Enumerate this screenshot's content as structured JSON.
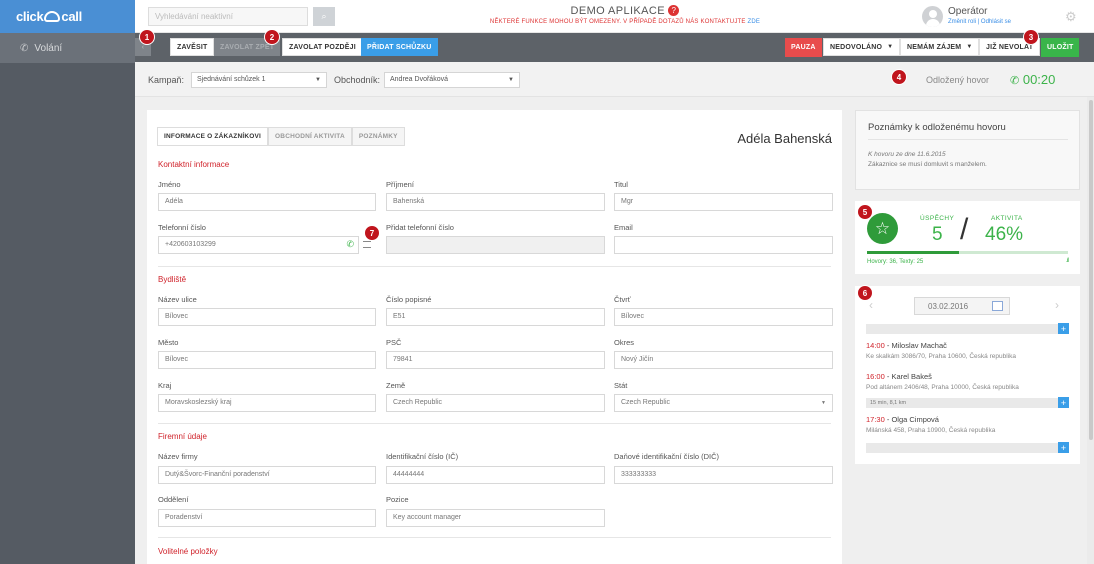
{
  "app": {
    "logo_text_1": "click",
    "logo_text_2": "call"
  },
  "sidebar": {
    "items": [
      {
        "label": "Volání",
        "icon": "phone-icon"
      }
    ]
  },
  "topbar": {
    "search_placeholder": "Vyhledávání neaktivní",
    "title": "DEMO APLIKACE",
    "subtitle": "NĚKTERÉ FUNKCE MOHOU BÝT OMEZENY. V PŘÍPADĚ DOTAZŮ NÁS KONTAKTUJTE",
    "subtitle_link": "ZDE",
    "user_name": "Operátor",
    "user_change_role": "Změnit roli",
    "user_sep": "|",
    "user_logout": "Odhlásit se"
  },
  "actions": {
    "hangup": "ZAVĚSIT",
    "callback": "ZAVOLAT ZPĚT",
    "call_later": "ZAVOLAT POZDĚJI",
    "add_meeting": "PŘIDAT SCHŮZKU",
    "pause": "PAUZA",
    "not_reached": "NEDOVOLÁNO",
    "not_interested": "NEMÁM ZÁJEM",
    "no_more_calls": "JIŽ NEVOLAT",
    "save": "ULOŽIT"
  },
  "markers": [
    "1",
    "2",
    "3",
    "4",
    "5",
    "6",
    "7"
  ],
  "campaign": {
    "label": "Kampaň:",
    "value": "Sjednávání schůzek 1",
    "dealer_label": "Obchodník:",
    "dealer_value": "Andrea Dvořáková",
    "delayed_label": "Odložený hovor",
    "timer": "00:20"
  },
  "tabs": [
    "INFORMACE O ZÁKAZNÍKOVI",
    "OBCHODNÍ AKTIVITA",
    "POZNÁMKY"
  ],
  "customer_name": "Adéla Bahenská",
  "sections": {
    "contact": "Kontaktní informace",
    "address": "Bydliště",
    "company": "Firemní údaje",
    "optional": "Volitelné položky"
  },
  "fields": {
    "first_name": {
      "label": "Jméno",
      "value": "Adéla"
    },
    "last_name": {
      "label": "Příjmení",
      "value": "Bahenská"
    },
    "title": {
      "label": "Titul",
      "value": "Mgr"
    },
    "phone": {
      "label": "Telefonní číslo",
      "value": "+420603103299"
    },
    "add_phone": {
      "label": "Přidat telefonní číslo",
      "value": ""
    },
    "email": {
      "label": "Email",
      "value": ""
    },
    "street": {
      "label": "Název ulice",
      "value": "Bílovec"
    },
    "house_no": {
      "label": "Číslo popisné",
      "value": "E51"
    },
    "district": {
      "label": "Čtvrť",
      "value": "Bílovec"
    },
    "city": {
      "label": "Město",
      "value": "Bílovec"
    },
    "zip": {
      "label": "PSČ",
      "value": "79841"
    },
    "county": {
      "label": "Okres",
      "value": "Nový Jičín"
    },
    "region": {
      "label": "Kraj",
      "value": "Moravskoslezský kraj"
    },
    "country": {
      "label": "Země",
      "value": "Czech Republic"
    },
    "state": {
      "label": "Stát",
      "value": "Czech Republic"
    },
    "company_name": {
      "label": "Název firmy",
      "value": "Dutý&Švorc-Finanční poradenství"
    },
    "ico": {
      "label": "Identifikační číslo (IČ)",
      "value": "44444444"
    },
    "dic": {
      "label": "Daňové identifikační číslo (DIČ)",
      "value": "333333333"
    },
    "department": {
      "label": "Oddělení",
      "value": "Poradenství"
    },
    "position": {
      "label": "Pozice",
      "value": "Key account manager"
    }
  },
  "notes": {
    "title": "Poznámky k odloženému hovoru",
    "date_line": "K hovoru ze dne 11.6.2015",
    "text": "Zákaznice se musí domluvit s manželem."
  },
  "stats": {
    "success_label": "ÚSPĚCHY",
    "success_value": "5",
    "activity_label": "AKTIVITA",
    "activity_value": "46%",
    "activity_fraction": 0.46,
    "footer": "Hovory: 36, Texty: 25",
    "signal": ".ıll"
  },
  "calendar": {
    "date": "03.02.2016",
    "prev": "‹",
    "next": "›",
    "plus": "+",
    "drive_info": "15 min, 8,1 km",
    "appointments": [
      {
        "time": "14:00",
        "name": "Miloslav Machač",
        "address": "Ke skalkám 3086/70, Praha 10600, Česká republika"
      },
      {
        "time": "16:00",
        "name": "Karel Bakeš",
        "address": "Pod altánem 2406/48, Praha 10000, Česká republika"
      },
      {
        "time": "17:30",
        "name": "Olga Cimpová",
        "address": "Milánská 458, Praha 10900, Česká republika"
      }
    ]
  },
  "colors": {
    "accent": "#3a9ee8",
    "danger": "#e84c4c",
    "success": "#39b54a",
    "section": "#d0232b"
  }
}
